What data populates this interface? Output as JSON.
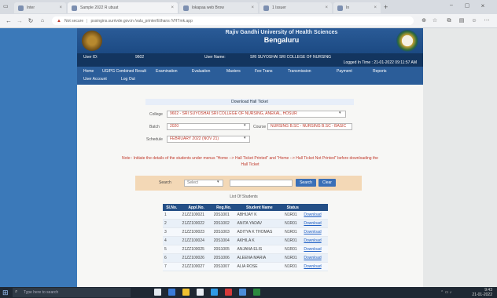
{
  "browser": {
    "tabs": [
      {
        "label": "Inter"
      },
      {
        "label": "Sample 2022 R ubuat"
      },
      {
        "label": "lokapaa web Brow"
      },
      {
        "label": "1 Issuer"
      },
      {
        "label": "In"
      }
    ],
    "url": "pssingins.surrivde.gov.in /valu_printer/Ethans /VHTmk.app",
    "url_prefix": "Not secure"
  },
  "header": {
    "title": "Rajiv Gandhi University of Health Sciences",
    "city": "Bengaluru"
  },
  "userbar": {
    "user_id_label": "User ID:",
    "user_id": "9602",
    "user_name_label": "User Name:",
    "user_name": "SRI SUYOSHAI SRI COLLEGE OF NURSING",
    "login_time": "Logged In Time : 21-01-2022 09:11:57 AM"
  },
  "menu": {
    "row1": [
      "Home",
      "UG/PG Combined Result",
      "Examination",
      "Evaluation",
      "Masters",
      "Fee Trans",
      "Transmission",
      "Payment",
      "Reports"
    ],
    "row2": [
      "User Account",
      "Log Out"
    ]
  },
  "form": {
    "panel_title": "Download Hall Ticket",
    "college_label": "College",
    "college_value": "9602 - SRI SUYOSHAI SRI COLLEGE OF NURSING, ANEKAL, HOSUR",
    "batch_label": "Batch",
    "batch_value": "2020",
    "course_label": "Course",
    "course_value": "NURSING B.SC - NURSING B.SC - BASIC",
    "schedule_label": "Schedule",
    "schedule_value": "FEBRUARY 2022 (NOV 21)"
  },
  "note": {
    "line1": "Note : Initiate the details of the students under menus \"Home --> Hall Ticket Printed\" and \"Home --> Hall Ticket Not Printed\" before downloading the",
    "line2": "Hall Ticket"
  },
  "search": {
    "label": "Search",
    "select_value": "Select",
    "input_placeholder": "",
    "search_button": "Search",
    "clear_button": "Clear"
  },
  "table": {
    "caption": "List Of Students",
    "headers": [
      "Sl.No.",
      "Appl.No.",
      "Reg.No.",
      "Student Name",
      "Status",
      ""
    ],
    "rows": [
      [
        "1",
        "21ZZ100021",
        "20S1001",
        "ABHIJAY K",
        "N1R01",
        "Download"
      ],
      [
        "2",
        "21ZZ100022",
        "20S1002",
        "ANITA YADAV",
        "N1R01",
        "Download"
      ],
      [
        "3",
        "21ZZ100023",
        "20S1003",
        "ADITYA K THOMAS",
        "N1R01",
        "Download"
      ],
      [
        "4",
        "21ZZ100024",
        "20S1004",
        "AKHILA K",
        "N1R01",
        "Download"
      ],
      [
        "5",
        "21ZZ100025",
        "20S1005",
        "ANJANA ELIS",
        "N1R01",
        "Download"
      ],
      [
        "6",
        "21ZZ100026",
        "20S1006",
        "ALEENA MARIA",
        "N1R01",
        "Download"
      ],
      [
        "7",
        "21ZZ100027",
        "20S1007",
        "ALIA ROSE",
        "N1R01",
        "Download"
      ]
    ]
  },
  "taskbar": {
    "search_placeholder": "Type here to search",
    "clock_time": "9:43",
    "clock_date": "21-01-2022"
  },
  "colors": {
    "header_blue": "#1f4e8a",
    "menu_blue": "#2b5d99",
    "note_red": "#c0392b",
    "search_panel": "#f3d8b6"
  }
}
